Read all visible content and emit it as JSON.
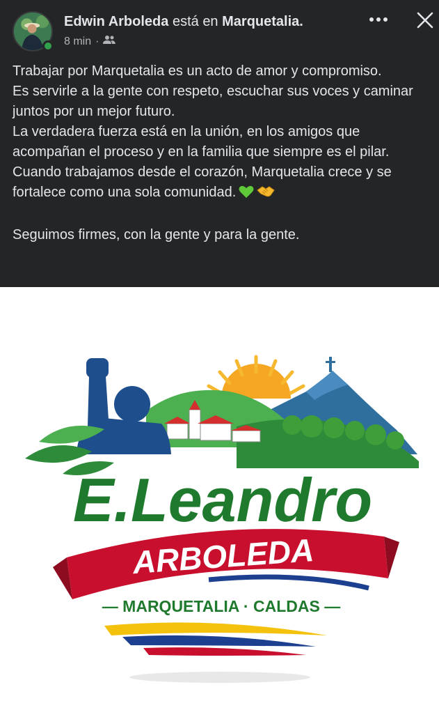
{
  "post": {
    "author": "Edwin Arboleda",
    "connector": "está en",
    "place": "Marquetalia.",
    "time": "8 min",
    "dot": "·",
    "audience_icon": "friends-icon",
    "more_icon": "more-icon",
    "close_icon": "close-icon",
    "paragraphs": [
      "Trabajar por Marquetalia es un acto de amor y compromiso.",
      "Es servirle a la gente con respeto, escuchar sus voces y caminar juntos por un mejor futuro.",
      "La verdadera fuerza está en la unión, en los amigos que acompañan el proceso y en la familia que siempre es el pilar.",
      "Cuando trabajamos desde el corazón, Marquetalia crece y se fortalece como una sola comunidad."
    ],
    "closing": "Seguimos firmes, con la gente y para la gente."
  },
  "image": {
    "name_script": "E.Leandro",
    "banner_text": "ARBOLEDA",
    "location": "— MARQUETALIA · CALDAS —"
  },
  "colors": {
    "post_bg": "#242526",
    "text": "#e4e6eb",
    "secondary": "#b0b3b8",
    "online": "#31a24c",
    "logo_green": "#1f7a2e",
    "logo_red": "#c8102e",
    "logo_blue": "#1d3f8f",
    "logo_yellow": "#f4c20d"
  }
}
